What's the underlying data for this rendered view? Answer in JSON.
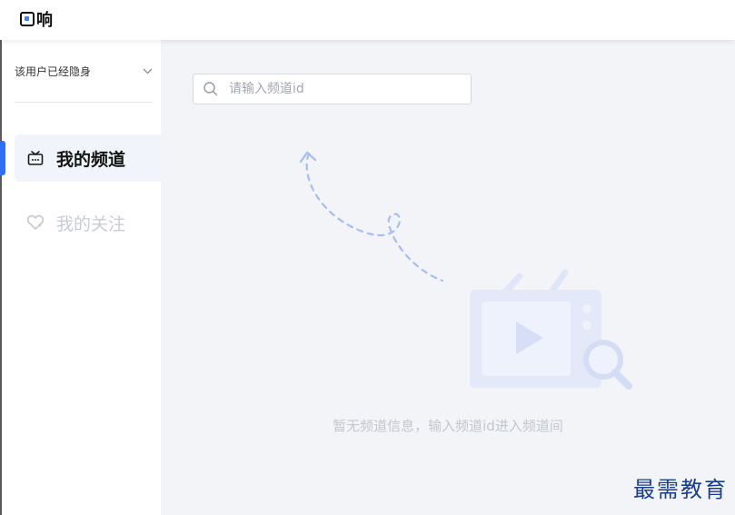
{
  "app": {
    "brand_name": "响"
  },
  "sidebar": {
    "user_status": "该用户已经隐身",
    "items": [
      {
        "label": "我的频道",
        "icon": "tv-icon",
        "active": true
      },
      {
        "label": "我的关注",
        "icon": "heart-icon",
        "active": false
      }
    ]
  },
  "search": {
    "placeholder": "请输入频道id",
    "value": ""
  },
  "empty_state": {
    "message": "暂无频道信息，输入频道id进入频道间"
  },
  "watermark": {
    "text": "最需教育"
  },
  "colors": {
    "accent": "#2f6ef5",
    "main_bg": "#f3f4f8",
    "active_item_bg": "#f1f4fa",
    "inactive_text": "#c9ccd3"
  }
}
